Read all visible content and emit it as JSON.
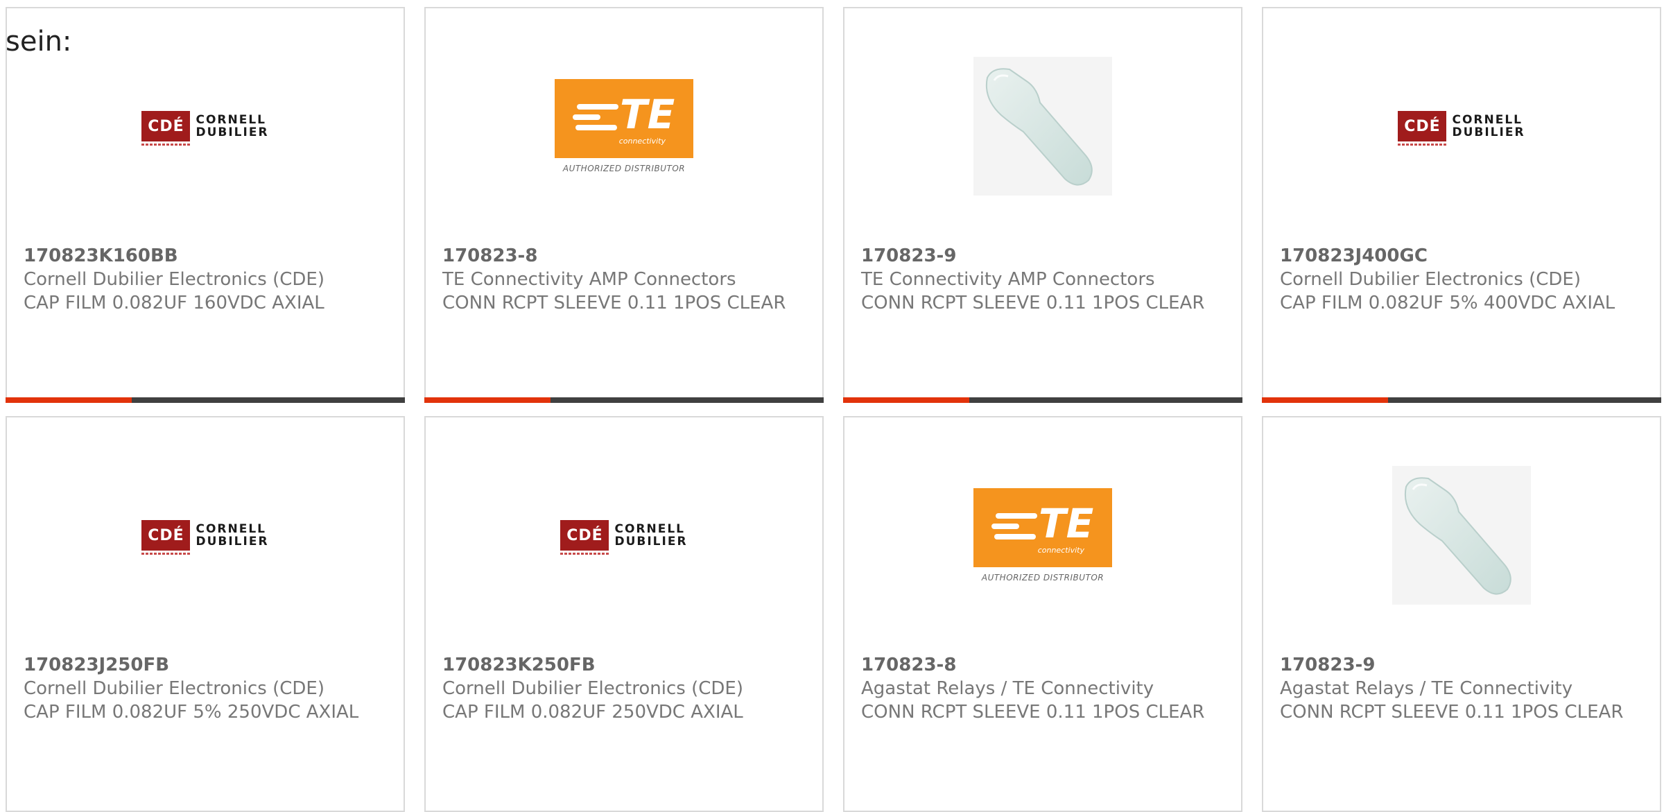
{
  "lead_text": "sein:",
  "colors": {
    "accent": "#e2330b",
    "bar": "#404040",
    "cde_red": "#a01c1c",
    "te_orange": "#f5941e"
  },
  "logos": {
    "cde": {
      "mark": "CDÉ",
      "line1": "CORNELL",
      "line2": "DUBILIER"
    },
    "te": {
      "word": "TE",
      "sub": "connectivity",
      "distributor": "AUTHORIZED DISTRIBUTOR"
    }
  },
  "products": [
    {
      "image": "cde-logo",
      "part": "170823K160BB",
      "manufacturer": "Cornell Dubilier Electronics (CDE)",
      "description": "CAP FILM 0.082UF 160VDC AXIAL"
    },
    {
      "image": "te-logo",
      "part": "170823-8",
      "manufacturer": "TE Connectivity AMP Connectors",
      "description": "CONN RCPT SLEEVE 0.11 1POS CLEAR"
    },
    {
      "image": "sleeve-photo",
      "part": "170823-9",
      "manufacturer": "TE Connectivity AMP Connectors",
      "description": "CONN RCPT SLEEVE 0.11 1POS CLEAR"
    },
    {
      "image": "cde-logo",
      "part": "170823J400GC",
      "manufacturer": "Cornell Dubilier Electronics (CDE)",
      "description": "CAP FILM 0.082UF 5% 400VDC AXIAL"
    },
    {
      "image": "cde-logo",
      "part": "170823J250FB",
      "manufacturer": "Cornell Dubilier Electronics (CDE)",
      "description": "CAP FILM 0.082UF 5% 250VDC AXIAL"
    },
    {
      "image": "cde-logo",
      "part": "170823K250FB",
      "manufacturer": "Cornell Dubilier Electronics (CDE)",
      "description": "CAP FILM 0.082UF 250VDC AXIAL"
    },
    {
      "image": "te-logo",
      "part": "170823-8",
      "manufacturer": "Agastat Relays / TE Connectivity",
      "description": "CONN RCPT SLEEVE 0.11 1POS CLEAR"
    },
    {
      "image": "sleeve-photo",
      "part": "170823-9",
      "manufacturer": "Agastat Relays / TE Connectivity",
      "description": "CONN RCPT SLEEVE 0.11 1POS CLEAR"
    }
  ]
}
